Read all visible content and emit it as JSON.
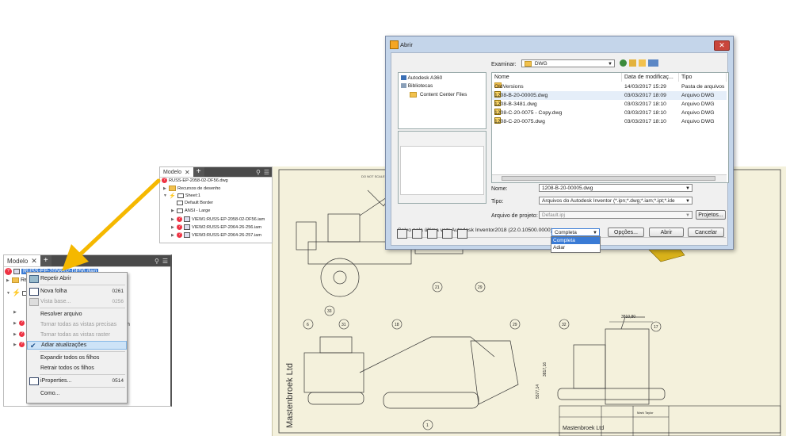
{
  "top_panel": {
    "tab": "Modelo",
    "close": "✕",
    "plus": "+",
    "root": "RUSS-EP-2058-02-DF56.dwg",
    "items": [
      {
        "label": "Recursos de desenho"
      },
      {
        "label": "Sheet:1"
      },
      {
        "label": "Default Border"
      },
      {
        "label": "ANSI - Large"
      },
      {
        "label": "VIEW1:RUSS-EP-2058-02-DF56.iam"
      },
      {
        "label": "VIEW2:RUSS-EP-2064-26-256.iam"
      },
      {
        "label": "VIEW3:RUSS-EP-2064-26-257.iam"
      }
    ]
  },
  "bottom_panel": {
    "tab": "Modelo",
    "close": "✕",
    "plus": "+",
    "root": "RUSS-EP-2058-02-DF56.dwg",
    "partial": "Re",
    "trail": "n"
  },
  "context_menu": {
    "items": [
      {
        "label": "Repetir Abrir",
        "shortcut": "",
        "disabled": false
      },
      {
        "label": "Nova folha",
        "shortcut": "0261",
        "disabled": false
      },
      {
        "label": "Vista base...",
        "shortcut": "0256",
        "disabled": true
      },
      {
        "label": "Resolver arquivo",
        "shortcut": "",
        "disabled": false
      },
      {
        "label": "Tornar todas as vistas precisas",
        "shortcut": "",
        "disabled": true
      },
      {
        "label": "Tornar todas as vistas raster",
        "shortcut": "",
        "disabled": true
      },
      {
        "label": "Adiar atualizações",
        "shortcut": "",
        "disabled": false
      },
      {
        "label": "Expandir todos os filhos",
        "shortcut": "",
        "disabled": false
      },
      {
        "label": "Retrair todos os filhos",
        "shortcut": "",
        "disabled": false
      },
      {
        "label": "iProperties...",
        "shortcut": "0514",
        "disabled": false
      },
      {
        "label": "Como...",
        "shortcut": "",
        "disabled": false
      }
    ]
  },
  "dialog": {
    "title": "Abrir",
    "close": "✕",
    "left_pane": [
      "Autodesk A360",
      "Bibliotecas",
      "Content Center Files"
    ],
    "examinar_label": "Examinar:",
    "examinar_value": "DWG",
    "columns": [
      "Nome",
      "Data de modificaç...",
      "Tipo"
    ],
    "files": [
      {
        "name": "OldVersions",
        "date": "14/03/2017 15:29",
        "type": "Pasta de arquivos",
        "kind": "folder"
      },
      {
        "name": "1208-B-20-00005.dwg",
        "date": "03/03/2017 18:09",
        "type": "Arquivo DWG",
        "kind": "dwg"
      },
      {
        "name": "1208-B-3481.dwg",
        "date": "03/03/2017 18:10",
        "type": "Arquivo DWG",
        "kind": "dwg"
      },
      {
        "name": "1208-C-20-0075 - Copy.dwg",
        "date": "03/03/2017 18:10",
        "type": "Arquivo DWG",
        "kind": "dwg"
      },
      {
        "name": "1208-C-20-0075.dwg",
        "date": "03/03/2017 18:10",
        "type": "Arquivo DWG",
        "kind": "dwg"
      }
    ],
    "nome_label": "Nome:",
    "nome_value": "1208-B-20-00005.dwg",
    "tipo_label": "Tipo:",
    "tipo_value": "Arquivos do Autodesk Inventor (*.ipn;*.dwg;*.iam;*.ipt;*.ide",
    "projeto_label": "Arquivo de projeto:",
    "projeto_value": "Default.ipj",
    "projetos_button": "Projetos...",
    "saved_text": "Salvo pela última vez: Autodesk Inventor2018 (22.0.10500.0000)",
    "mode_value": "Completa",
    "mode_options": [
      "Completa",
      "Adiar"
    ],
    "opcoes_button": "Opções...",
    "abrir_button": "Abrir",
    "cancelar_button": "Cancelar"
  },
  "sheet": {
    "company_side": "Mastenbroek Ltd",
    "company_block": "Mastenbroek Ltd",
    "dim1": "3810,80",
    "dim2": "5577,14",
    "dim3": "3817,16",
    "do_not_scale": "DO NOT SCALE",
    "balloons": [
      "21",
      "29",
      "33",
      "6",
      "31",
      "18",
      "29",
      "32",
      "17",
      "1"
    ],
    "author": "Mark Taylor"
  },
  "colors": {
    "arrow": "#f5b800",
    "highlight": "#cde3f7"
  }
}
